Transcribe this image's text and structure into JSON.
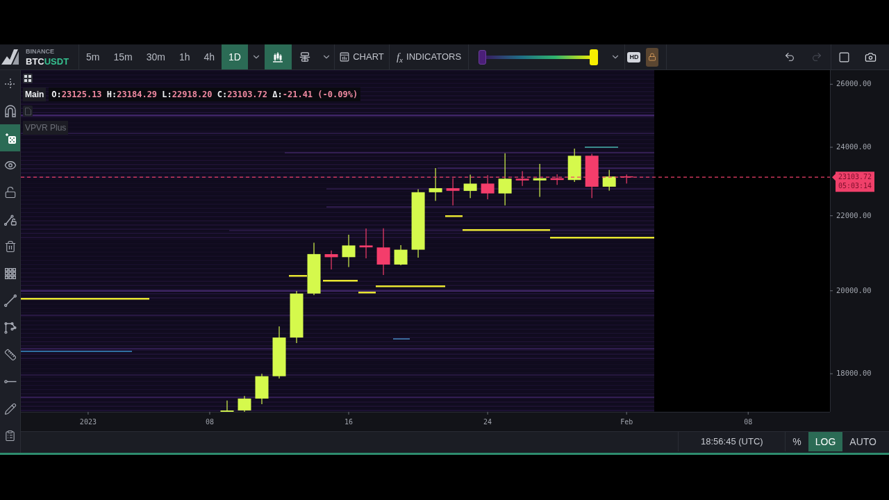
{
  "toolbar": {
    "exchange": "BINANCE",
    "base": "BTC",
    "quote": "USDT",
    "timeframes": [
      {
        "label": "5m",
        "selected": false
      },
      {
        "label": "15m",
        "selected": false
      },
      {
        "label": "30m",
        "selected": false
      },
      {
        "label": "1h",
        "selected": false
      },
      {
        "label": "4h",
        "selected": false
      },
      {
        "label": "1D",
        "selected": true
      }
    ],
    "chart_type": {
      "selected": true
    },
    "chart_button": "CHART",
    "indicators_button": {
      "symbol": "f$_{x}$",
      "label": "INDICATORS"
    },
    "heatmap_range": {
      "thumbs": [
        {
          "level": 0
        },
        {
          "level": 1
        }
      ]
    },
    "hd_button": "HD",
    "lock": {
      "on": true
    },
    "undo": {
      "disabled": false
    },
    "redo": {
      "disabled": true
    }
  },
  "sidebar": {
    "tools": [
      {
        "selected": false
      },
      {
        "selected": false
      },
      {
        "selected": true
      },
      {
        "selected": false
      },
      {
        "selected": false
      },
      {
        "selected": false
      },
      {
        "selected": false
      },
      {
        "selected": false
      },
      {
        "selected": false
      },
      {
        "selected": false
      },
      {
        "selected": false
      },
      {
        "selected": false
      },
      {
        "selected": false
      },
      {
        "selected": false
      }
    ]
  },
  "chart": {
    "pane_label": "Main",
    "ohlc": [
      {
        "label": "O:",
        "value": "23125.13"
      },
      {
        "label": "H:",
        "value": "23184.29"
      },
      {
        "label": "L:",
        "value": "22918.20"
      },
      {
        "label": "C:",
        "value": "23103.72"
      },
      {
        "label": "Δ:",
        "value": "-21.41 (-0.09%)"
      }
    ],
    "indicator_label": "VPVR Plus",
    "countdown": "05:03:14",
    "chart_data": [
      {
        "type": "candlestick",
        "log": true,
        "x": [
          "2023-01-09",
          "2023-01-10",
          "2023-01-11",
          "2023-01-12",
          "2023-01-13",
          "2023-01-14",
          "2023-01-15",
          "2023-01-16",
          "2023-01-17",
          "2023-01-18",
          "2023-01-19",
          "2023-01-20",
          "2023-01-21",
          "2023-01-22",
          "2023-01-23",
          "2023-01-24",
          "2023-01-25",
          "2023-01-26",
          "2023-01-27",
          "2023-01-28",
          "2023-01-29",
          "2023-01-30",
          "2023-01-31",
          "2023-02-01"
        ],
        "ohlc": [
          [
            17127.83,
            17398.8,
            17104.66,
            17178.26
          ],
          [
            17179.04,
            17499,
            17146.34,
            17440.66
          ],
          [
            17440.64,
            18000,
            17315.6,
            17943.26
          ],
          [
            17943.26,
            19117.04,
            17892.05,
            18846.62
          ],
          [
            18846.62,
            19995,
            18714.12,
            19930.01
          ],
          [
            19930.01,
            21258,
            19888.05,
            20954.92
          ],
          [
            20952.76,
            21050.74,
            20551.01,
            20871.5
          ],
          [
            20872.99,
            21474.05,
            20611.48,
            21185.65
          ],
          [
            21185.65,
            21647.45,
            20841.31,
            21134.81
          ],
          [
            21132.29,
            21650,
            20407.15,
            20677.47
          ],
          [
            20677.47,
            21192,
            20659.19,
            21071.59
          ],
          [
            21071.59,
            22755.93,
            20861.28,
            22667.21
          ],
          [
            22666,
            23371.8,
            22422,
            22783.55
          ],
          [
            22783.35,
            23078.71,
            22292.37,
            22707.88
          ],
          [
            22706.02,
            23180,
            22500,
            22916.45
          ],
          [
            22917.81,
            23162.2,
            22462.93,
            22632.89
          ],
          [
            22631.94,
            23816.73,
            22292.37,
            23060.94
          ],
          [
            23060.42,
            23282.47,
            22850.01,
            23009.65
          ],
          [
            23009.65,
            23500,
            22534.88,
            23074.16
          ],
          [
            23074.16,
            23189,
            22878.46,
            23022.6
          ],
          [
            23022.6,
            23960.54,
            22967.76,
            23742.3
          ],
          [
            23743.37,
            23800.51,
            22500,
            22826.12
          ],
          [
            22827.38,
            23320,
            22714.77,
            23125.13
          ],
          [
            23125.13,
            23184.29,
            22918.2,
            23103.72
          ]
        ],
        "xlim": [
          "2022-12-28T03:00",
          "2023-02-12T17:00"
        ],
        "ylim": [
          17150,
          26470
        ],
        "xticks": [
          {
            "value": "2023-01-01",
            "label": "2023"
          },
          {
            "value": "2023-01-08",
            "label": "08"
          },
          {
            "value": "2023-01-16",
            "label": "16"
          },
          {
            "value": "2023-01-24",
            "label": "24"
          },
          {
            "value": "2023-02-01",
            "label": "Feb"
          },
          {
            "value": "2023-02-08",
            "label": "08"
          }
        ],
        "yticks": [
          {
            "value": 18000,
            "label": "18000.00"
          },
          {
            "value": 20000,
            "label": "20000.00"
          },
          {
            "value": 22000,
            "label": "22000.00"
          },
          {
            "value": 24000,
            "label": "24000.00"
          },
          {
            "value": 26000,
            "label": "26000.00"
          }
        ],
        "ref_lines": [
          {
            "axis": "y",
            "value": 23103.72,
            "label": "23103.72",
            "color": "#f0406a",
            "line_style": "dashed"
          }
        ]
      }
    ]
  },
  "status_bar": {
    "time": "18:56:45 (UTC)",
    "scale_buttons": [
      {
        "label": "%",
        "selected": false
      },
      {
        "label": "LOG",
        "selected": true
      },
      {
        "label": "AUTO",
        "selected": false
      }
    ]
  }
}
